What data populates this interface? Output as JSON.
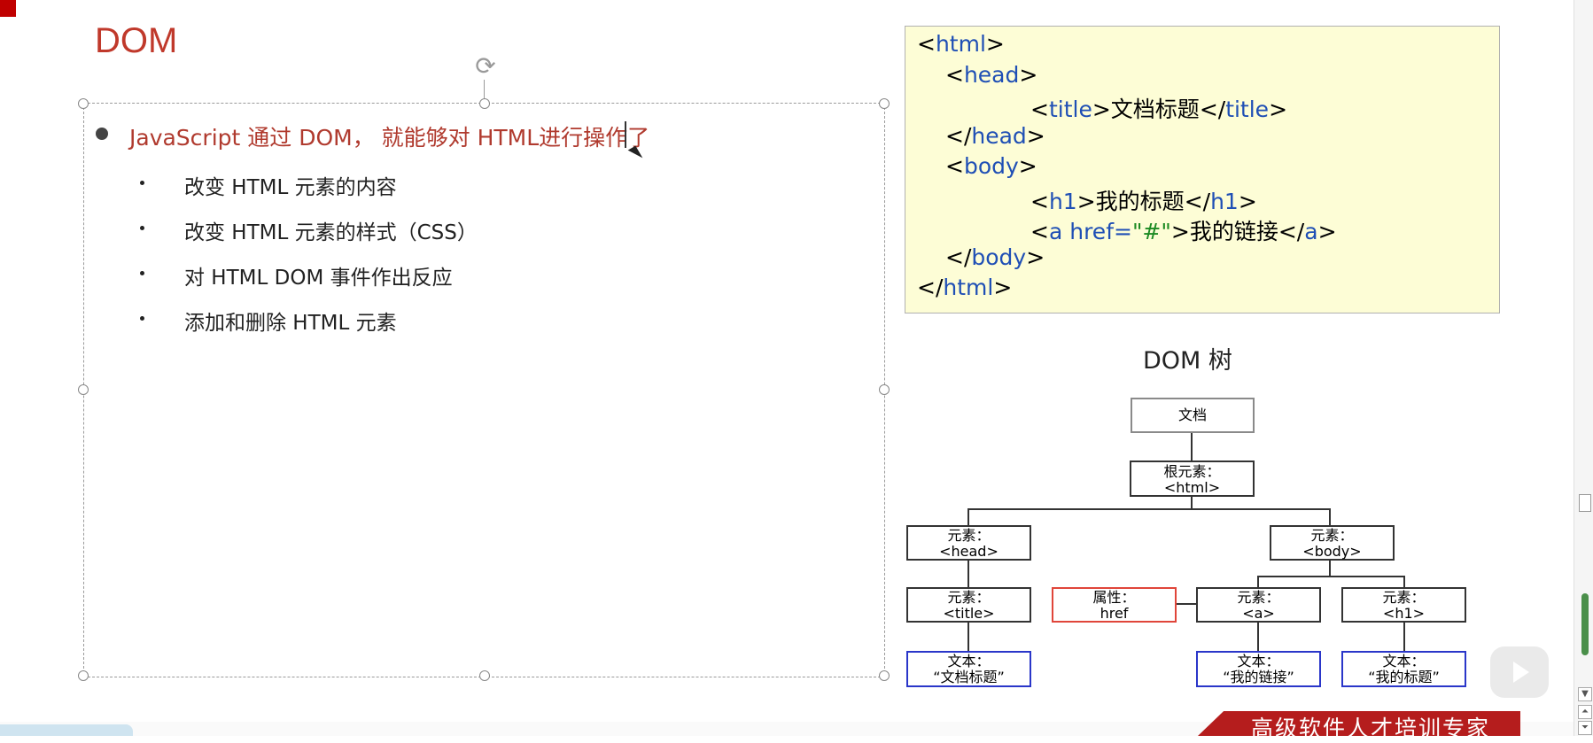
{
  "slide": {
    "title": "DOM",
    "main_bullet": "JavaScript 通过 DOM， 就能够对 HTML进行操作了",
    "sub_items": [
      "改变 HTML 元素的内容",
      "改变 HTML 元素的样式（CSS）",
      "对 HTML DOM 事件作出反应",
      "添加和删除 HTML 元素"
    ]
  },
  "code": {
    "html_open": "html",
    "head_open": "head",
    "title_tag": "title",
    "title_text": "文档标题",
    "body_tag": "body",
    "h1_tag": "h1",
    "h1_text": "我的标题",
    "a_tag": "a",
    "a_attr": "href=",
    "a_value": "\"#\"",
    "a_text": "我的链接"
  },
  "tree": {
    "title": "DOM 树",
    "doc": "文档",
    "root_label": "根元素：",
    "root_tag": "<html>",
    "head_label": "元素：",
    "head_tag": "<head>",
    "body_label": "元素：",
    "body_tag": "<body>",
    "title_label": "元素：",
    "title_tag": "<title>",
    "attr_label": "属性：",
    "attr_value": "href",
    "a_label": "元素：",
    "a_tag": "<a>",
    "h1_label": "元素：",
    "h1_tag": "<h1>",
    "text1_label": "文本：",
    "text1_value": "“文档标题”",
    "text2_label": "文本：",
    "text2_value": "“我的链接”",
    "text3_label": "文本：",
    "text3_value": "“我的标题”"
  },
  "footer": {
    "banner_text": "高级软件人才培训专家"
  },
  "colors": {
    "title_red": "#c0392b",
    "code_bg": "#fdfdd6",
    "tag_blue": "#1f4fb5",
    "string_green": "#1b8a22",
    "attr_red": "#e0453a",
    "text_blue": "#2a36c9",
    "banner_red": "#b51d1d"
  }
}
